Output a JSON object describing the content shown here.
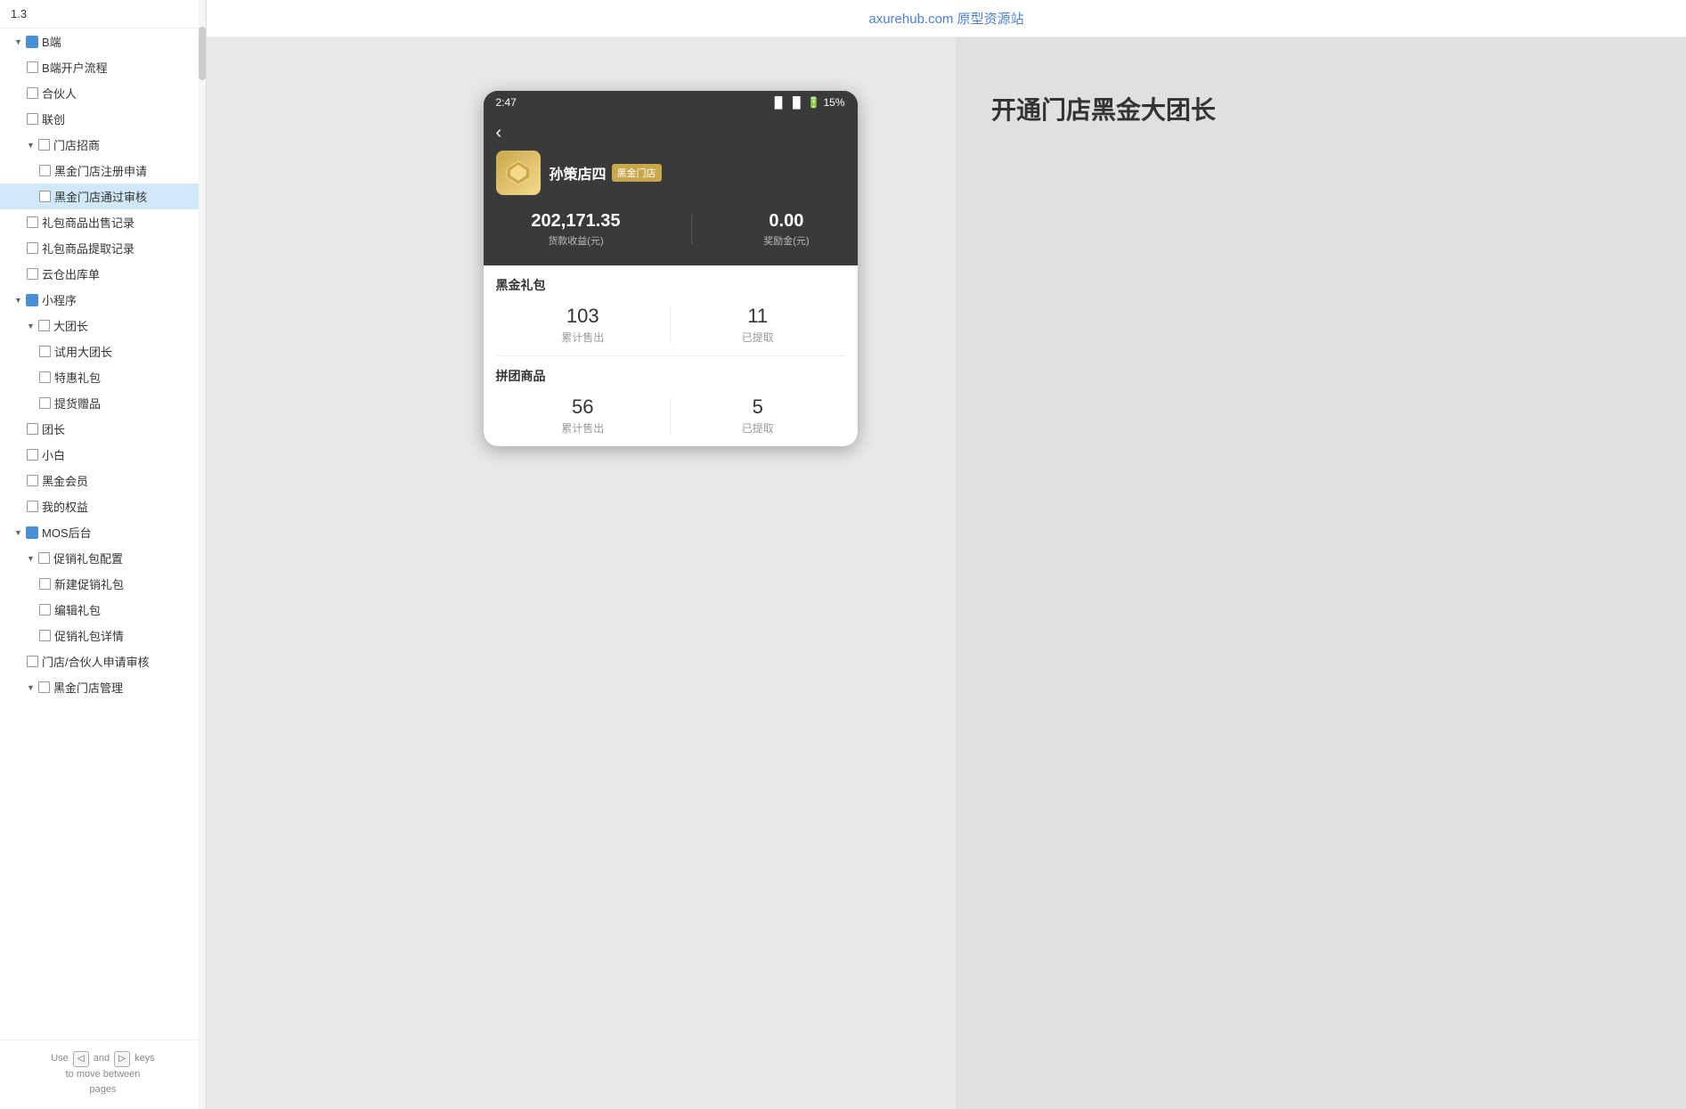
{
  "version": "1.3",
  "topbar": {
    "title": "axurehub.com 原型资源站"
  },
  "sidebar": {
    "items": [
      {
        "id": "b-end",
        "label": "B端",
        "type": "folder",
        "level": 1,
        "expanded": true
      },
      {
        "id": "b-open",
        "label": "B端开户流程",
        "type": "page",
        "level": 2
      },
      {
        "id": "partner",
        "label": "合伙人",
        "type": "page",
        "level": 2
      },
      {
        "id": "joint",
        "label": "联创",
        "type": "page",
        "level": 2
      },
      {
        "id": "store-recruit",
        "label": "门店招商",
        "type": "folder-expand",
        "level": 2,
        "expanded": true
      },
      {
        "id": "black-register",
        "label": "黑金门店注册申请",
        "type": "page",
        "level": 3
      },
      {
        "id": "black-approved",
        "label": "黑金门店通过审核",
        "type": "page",
        "level": 3,
        "active": true
      },
      {
        "id": "gift-sales",
        "label": "礼包商品出售记录",
        "type": "page",
        "level": 2
      },
      {
        "id": "gift-pickup",
        "label": "礼包商品提取记录",
        "type": "page",
        "level": 2
      },
      {
        "id": "cloud-stock",
        "label": "云仓出库单",
        "type": "page",
        "level": 2
      },
      {
        "id": "mini-prog",
        "label": "小程序",
        "type": "folder",
        "level": 1,
        "expanded": true
      },
      {
        "id": "big-leader",
        "label": "大团长",
        "type": "folder-expand",
        "level": 2,
        "expanded": true
      },
      {
        "id": "try-leader",
        "label": "试用大团长",
        "type": "page",
        "level": 3
      },
      {
        "id": "special-gift",
        "label": "特惠礼包",
        "type": "page",
        "level": 3
      },
      {
        "id": "pickup-gift",
        "label": "提货赠品",
        "type": "page",
        "level": 3
      },
      {
        "id": "leader",
        "label": "团长",
        "type": "page",
        "level": 2
      },
      {
        "id": "xiaobai",
        "label": "小白",
        "type": "page",
        "level": 2
      },
      {
        "id": "black-member",
        "label": "黑金会员",
        "type": "page",
        "level": 2
      },
      {
        "id": "my-rights",
        "label": "我的权益",
        "type": "page",
        "level": 2
      },
      {
        "id": "mos-backend",
        "label": "MOS后台",
        "type": "folder",
        "level": 1,
        "expanded": true
      },
      {
        "id": "promo-config",
        "label": "促销礼包配置",
        "type": "folder-expand",
        "level": 2,
        "expanded": true
      },
      {
        "id": "new-promo",
        "label": "新建促销礼包",
        "type": "page",
        "level": 3
      },
      {
        "id": "edit-gift",
        "label": "编辑礼包",
        "type": "page",
        "level": 3
      },
      {
        "id": "promo-detail",
        "label": "促销礼包详情",
        "type": "page",
        "level": 3
      },
      {
        "id": "store-apply",
        "label": "门店/合伙人申请审核",
        "type": "page",
        "level": 2
      },
      {
        "id": "black-store-mgmt",
        "label": "黑金门店管理",
        "type": "folder-expand",
        "level": 2
      }
    ]
  },
  "footer": {
    "use_text": "Use",
    "and_text": "and",
    "keys_text": "keys",
    "move_text": "to move between",
    "pages_text": "pages",
    "key_left": "◁",
    "key_right": "▷"
  },
  "phone": {
    "status_bar": {
      "time": "2:47",
      "icons": "📶 📶 🔋 15%"
    },
    "store_name": "孙策店四",
    "store_badge": "黑金门店",
    "stat1_value": "202,171.35",
    "stat1_label": "货款收益(元)",
    "stat2_value": "0.00",
    "stat2_label": "奖励金(元)",
    "section1_title": "黑金礼包",
    "section1_stat1_value": "103",
    "section1_stat1_label": "累计售出",
    "section1_stat2_value": "11",
    "section1_stat2_label": "已提取",
    "section2_title": "拼团商品",
    "section2_stat1_value": "56",
    "section2_stat2_value": "5"
  },
  "right_panel": {
    "text": "开通门店黑金大团长"
  }
}
